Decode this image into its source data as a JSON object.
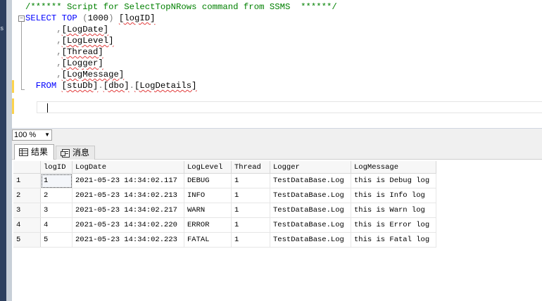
{
  "sidebar": {
    "clip_label": "s"
  },
  "editor": {
    "lines": [
      {
        "parts": [
          {
            "t": "/****** Script for SelectTopNRows command from SSMS  ******/",
            "c": "cm"
          }
        ]
      },
      {
        "parts": [
          {
            "t": "SELECT TOP ",
            "c": "kw"
          },
          {
            "t": "(",
            "c": "gr"
          },
          {
            "t": "1000",
            "c": ""
          },
          {
            "t": ")",
            "c": "gr"
          },
          {
            "t": " ",
            "c": ""
          },
          {
            "t": "[logID]",
            "c": "sq"
          }
        ]
      },
      {
        "parts": [
          {
            "t": "      ",
            "c": ""
          },
          {
            "t": ",",
            "c": "gr"
          },
          {
            "t": "[LogDate]",
            "c": "sq"
          }
        ]
      },
      {
        "parts": [
          {
            "t": "      ",
            "c": ""
          },
          {
            "t": ",",
            "c": "gr"
          },
          {
            "t": "[LogLevel]",
            "c": "sq"
          }
        ]
      },
      {
        "parts": [
          {
            "t": "      ",
            "c": ""
          },
          {
            "t": ",",
            "c": "gr"
          },
          {
            "t": "[Thread]",
            "c": "sq"
          }
        ]
      },
      {
        "parts": [
          {
            "t": "      ",
            "c": ""
          },
          {
            "t": ",",
            "c": "gr"
          },
          {
            "t": "[Logger]",
            "c": "sq"
          }
        ]
      },
      {
        "parts": [
          {
            "t": "      ",
            "c": ""
          },
          {
            "t": ",",
            "c": "gr"
          },
          {
            "t": "[LogMessage]",
            "c": "sq"
          }
        ]
      },
      {
        "parts": [
          {
            "t": "  FROM ",
            "c": "kw"
          },
          {
            "t": "[stuDb]",
            "c": "sq"
          },
          {
            "t": ".",
            "c": "gr"
          },
          {
            "t": "[dbo]",
            "c": "sq"
          },
          {
            "t": ".",
            "c": "gr"
          },
          {
            "t": "[LogDetails]",
            "c": "sq"
          }
        ]
      }
    ]
  },
  "zoom": {
    "value": "100 %"
  },
  "tabs": {
    "results": "结果",
    "messages": "消息"
  },
  "grid": {
    "columns": [
      "logID",
      "LogDate",
      "LogLevel",
      "Thread",
      "Logger",
      "LogMessage"
    ],
    "rows": [
      {
        "num": "1",
        "cells": [
          "1",
          "2021-05-23 14:34:02.117",
          "DEBUG",
          "1",
          "TestDataBase.Log",
          "this is Debug log"
        ]
      },
      {
        "num": "2",
        "cells": [
          "2",
          "2021-05-23 14:34:02.213",
          "INFO",
          "1",
          "TestDataBase.Log",
          "this is Info log"
        ]
      },
      {
        "num": "3",
        "cells": [
          "3",
          "2021-05-23 14:34:02.217",
          "WARN",
          "1",
          "TestDataBase.Log",
          "this is Warn log"
        ]
      },
      {
        "num": "4",
        "cells": [
          "4",
          "2021-05-23 14:34:02.220",
          "ERROR",
          "1",
          "TestDataBase.Log",
          "this is Error log"
        ]
      },
      {
        "num": "5",
        "cells": [
          "5",
          "2021-05-23 14:34:02.223",
          "FATAL",
          "1",
          "TestDataBase.Log",
          "this is Fatal log"
        ]
      }
    ]
  }
}
